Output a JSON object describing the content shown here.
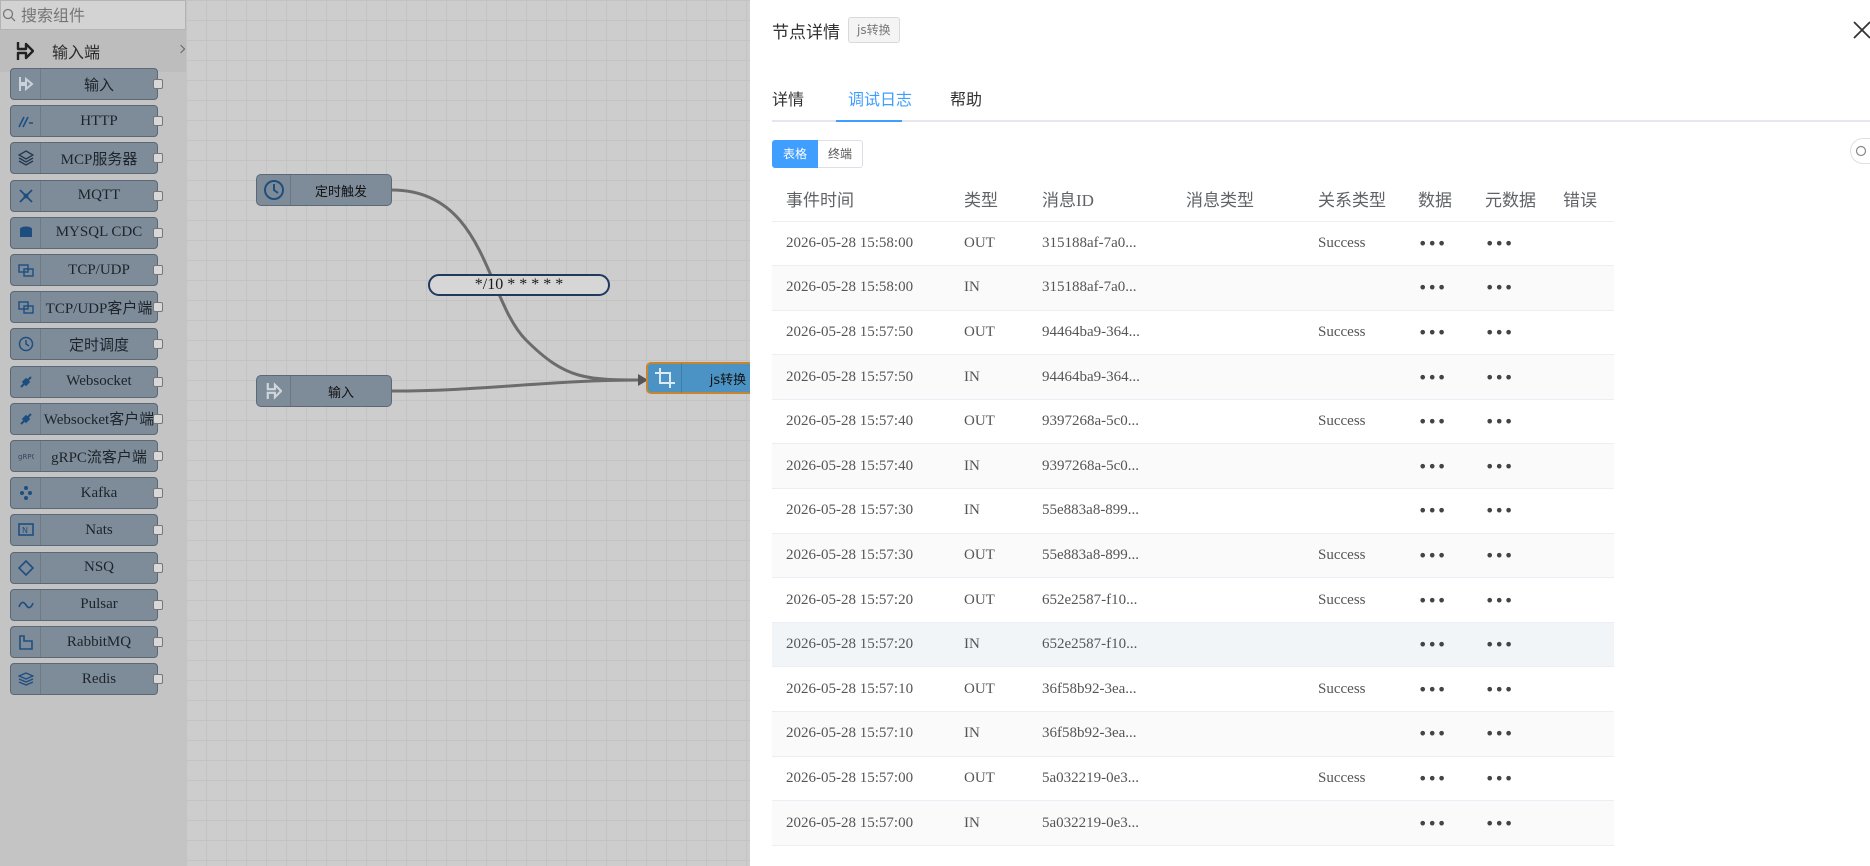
{
  "palette": {
    "search_placeholder": "搜索组件",
    "category": "输入端",
    "items": [
      {
        "label": "输入",
        "icon": "input-arrow-icon"
      },
      {
        "label": "HTTP",
        "icon": "http-icon"
      },
      {
        "label": "MCP服务器",
        "icon": "layers-icon"
      },
      {
        "label": "MQTT",
        "icon": "mqtt-icon"
      },
      {
        "label": "MYSQL CDC",
        "icon": "database-icon"
      },
      {
        "label": "TCP/UDP",
        "icon": "network-icon"
      },
      {
        "label": "TCP/UDP客户端",
        "icon": "network-icon"
      },
      {
        "label": "定时调度",
        "icon": "clock-icon"
      },
      {
        "label": "Websocket",
        "icon": "plug-icon"
      },
      {
        "label": "Websocket客户端",
        "icon": "plug-icon"
      },
      {
        "label": "gRPC流客户端",
        "icon": "grpc-icon"
      },
      {
        "label": "Kafka",
        "icon": "kafka-icon"
      },
      {
        "label": "Nats",
        "icon": "nats-icon"
      },
      {
        "label": "NSQ",
        "icon": "nsq-icon"
      },
      {
        "label": "Pulsar",
        "icon": "pulsar-icon"
      },
      {
        "label": "RabbitMQ",
        "icon": "rabbitmq-icon"
      },
      {
        "label": "Redis",
        "icon": "redis-icon"
      }
    ]
  },
  "canvas": {
    "nodes": {
      "timer": "定时触发",
      "input": "输入",
      "transform": "js转换"
    },
    "edge_label": "*/10 * * * * *"
  },
  "drawer": {
    "title": "节点详情",
    "tag": "js转换",
    "tabs": [
      "详情",
      "调试日志",
      "帮助"
    ],
    "active_tab": "调试日志",
    "view_toggle": [
      "表格",
      "终端"
    ],
    "columns": [
      "事件时间",
      "类型",
      "消息ID",
      "消息类型",
      "关系类型",
      "数据",
      "元数据",
      "错误"
    ],
    "rows": [
      {
        "time": "2026-05-28 15:58:00",
        "type": "OUT",
        "id": "315188af-7a0...",
        "msg_type": "",
        "rel": "Success",
        "data": "•••",
        "meta": "•••",
        "err": ""
      },
      {
        "time": "2026-05-28 15:58:00",
        "type": "IN",
        "id": "315188af-7a0...",
        "msg_type": "",
        "rel": "",
        "data": "•••",
        "meta": "•••",
        "err": ""
      },
      {
        "time": "2026-05-28 15:57:50",
        "type": "OUT",
        "id": "94464ba9-364...",
        "msg_type": "",
        "rel": "Success",
        "data": "•••",
        "meta": "•••",
        "err": ""
      },
      {
        "time": "2026-05-28 15:57:50",
        "type": "IN",
        "id": "94464ba9-364...",
        "msg_type": "",
        "rel": "",
        "data": "•••",
        "meta": "•••",
        "err": ""
      },
      {
        "time": "2026-05-28 15:57:40",
        "type": "OUT",
        "id": "9397268a-5c0...",
        "msg_type": "",
        "rel": "Success",
        "data": "•••",
        "meta": "•••",
        "err": ""
      },
      {
        "time": "2026-05-28 15:57:40",
        "type": "IN",
        "id": "9397268a-5c0...",
        "msg_type": "",
        "rel": "",
        "data": "•••",
        "meta": "•••",
        "err": ""
      },
      {
        "time": "2026-05-28 15:57:30",
        "type": "IN",
        "id": "55e883a8-899...",
        "msg_type": "",
        "rel": "",
        "data": "•••",
        "meta": "•••",
        "err": ""
      },
      {
        "time": "2026-05-28 15:57:30",
        "type": "OUT",
        "id": "55e883a8-899...",
        "msg_type": "",
        "rel": "Success",
        "data": "•••",
        "meta": "•••",
        "err": ""
      },
      {
        "time": "2026-05-28 15:57:20",
        "type": "OUT",
        "id": "652e2587-f10...",
        "msg_type": "",
        "rel": "Success",
        "data": "•••",
        "meta": "•••",
        "err": ""
      },
      {
        "time": "2026-05-28 15:57:20",
        "type": "IN",
        "id": "652e2587-f10...",
        "msg_type": "",
        "rel": "",
        "data": "•••",
        "meta": "•••",
        "err": ""
      },
      {
        "time": "2026-05-28 15:57:10",
        "type": "OUT",
        "id": "36f58b92-3ea...",
        "msg_type": "",
        "rel": "Success",
        "data": "•••",
        "meta": "•••",
        "err": ""
      },
      {
        "time": "2026-05-28 15:57:10",
        "type": "IN",
        "id": "36f58b92-3ea...",
        "msg_type": "",
        "rel": "",
        "data": "•••",
        "meta": "•••",
        "err": ""
      },
      {
        "time": "2026-05-28 15:57:00",
        "type": "OUT",
        "id": "5a032219-0e3...",
        "msg_type": "",
        "rel": "Success",
        "data": "•••",
        "meta": "•••",
        "err": ""
      },
      {
        "time": "2026-05-28 15:57:00",
        "type": "IN",
        "id": "5a032219-0e3...",
        "msg_type": "",
        "rel": "",
        "data": "•••",
        "meta": "•••",
        "err": ""
      }
    ]
  },
  "colors": {
    "accent": "#409eff",
    "node": "#7e8c9a",
    "selected_node": "#4b93c4",
    "selected_border": "#c9852d"
  }
}
